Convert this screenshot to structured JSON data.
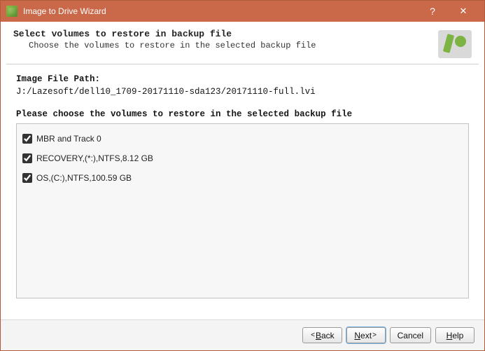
{
  "titlebar": {
    "title": "Image to Drive Wizard",
    "help_tooltip": "?",
    "close_tooltip": "✕"
  },
  "header": {
    "heading": "Select volumes to restore in backup file",
    "sub": "Choose the volumes to restore in the selected backup file"
  },
  "body": {
    "path_label": "Image File Path:",
    "path_value": "J:/Lazesoft/dell10_1709-20171110-sda123/20171110-full.lvi",
    "instruction": "Please choose the volumes to restore in the selected backup file",
    "volumes": [
      {
        "label": "MBR and Track 0",
        "checked": true
      },
      {
        "label": "RECOVERY,(*:),NTFS,8.12 GB",
        "checked": true
      },
      {
        "label": "OS,(C:),NTFS,100.59 GB",
        "checked": true
      }
    ]
  },
  "footer": {
    "back": "Back",
    "next": "Next",
    "cancel": "Cancel",
    "help": "Help"
  }
}
